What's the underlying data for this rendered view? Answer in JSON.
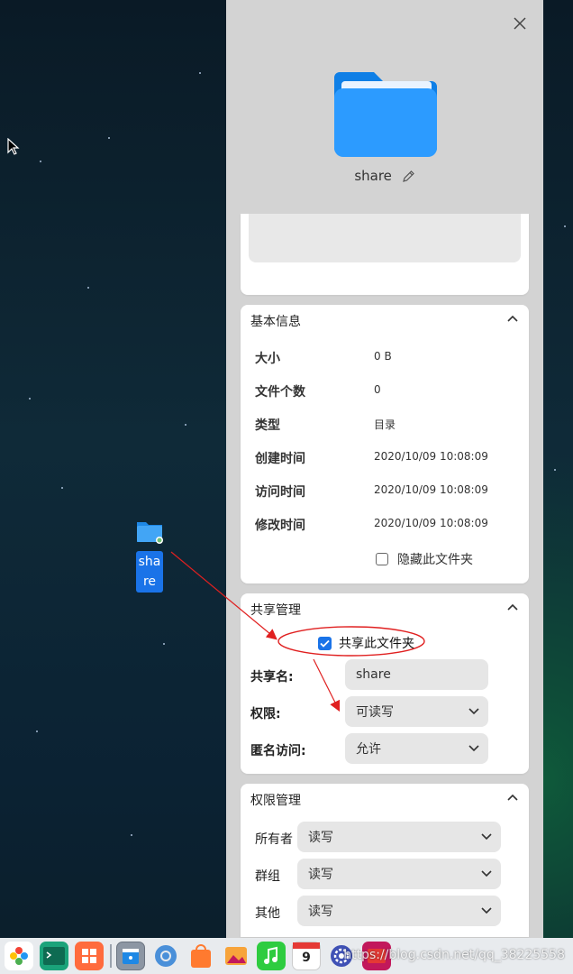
{
  "desktop": {
    "folder_label": "share"
  },
  "panel": {
    "folder_name": "share",
    "basic": {
      "title": "基本信息",
      "rows": [
        {
          "key": "大小",
          "value": "0 B"
        },
        {
          "key": "文件个数",
          "value": "0"
        },
        {
          "key": "类型",
          "value": "目录"
        },
        {
          "key": "创建时间",
          "value": "2020/10/09 10:08:09"
        },
        {
          "key": "访问时间",
          "value": "2020/10/09 10:08:09"
        },
        {
          "key": "修改时间",
          "value": "2020/10/09 10:08:09"
        }
      ],
      "hide_label": "隐藏此文件夹",
      "hide_checked": false
    },
    "share": {
      "title": "共享管理",
      "checkbox_label": "共享此文件夹",
      "checked": true,
      "name_label": "共享名:",
      "name_value": "share",
      "perm_label": "权限:",
      "perm_value": "可读写",
      "anon_label": "匿名访问:",
      "anon_value": "允许"
    },
    "permissions": {
      "title": "权限管理",
      "owner_label": "所有者",
      "owner_value": "读写",
      "group_label": "群组",
      "group_value": "读写",
      "other_label": "其他",
      "other_value": "读写"
    }
  },
  "taskbar": {
    "apps": [
      "launcher-icon",
      "terminal-icon",
      "app-store-icon",
      "file-manager-icon",
      "browser-icon",
      "store-bag-icon",
      "photos-icon",
      "music-icon",
      "calendar-icon",
      "settings-icon",
      "screen-recorder-icon"
    ],
    "calendar_day": "9",
    "watermark": "https://blog.csdn.net/qq_38225558"
  },
  "colors": {
    "accent": "#1a73e8",
    "annotation": "#e02020"
  }
}
